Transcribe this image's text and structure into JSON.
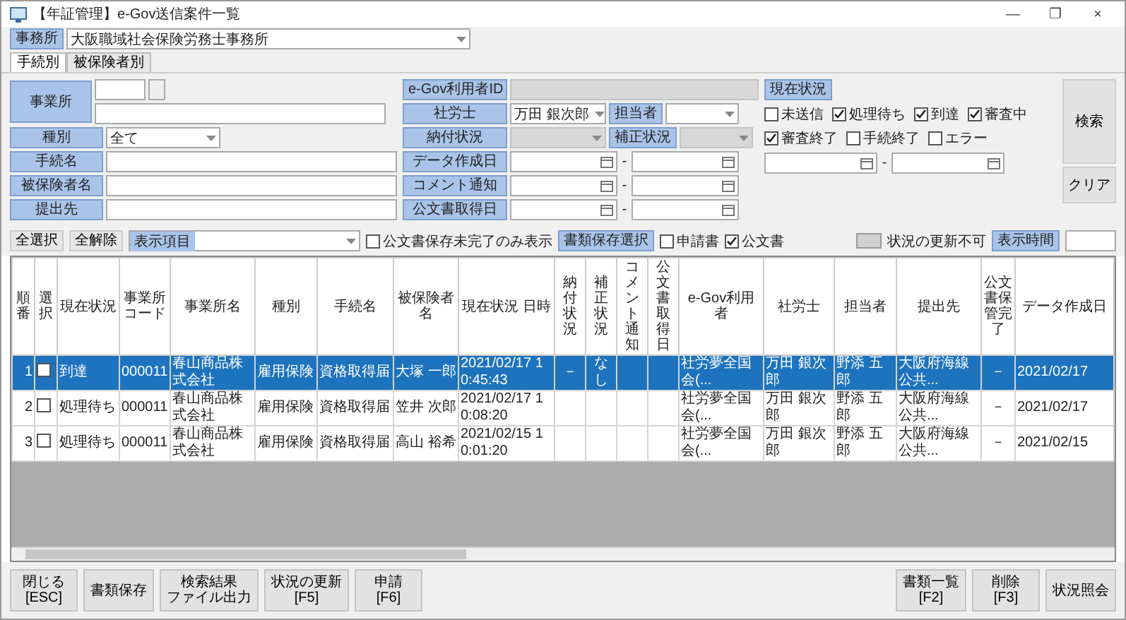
{
  "window": {
    "title": "【年証管理】e-Gov送信案件一覧",
    "controls": [
      "—",
      "❐",
      "×"
    ]
  },
  "office": {
    "label": "事務所",
    "value": "大阪職域社会保険労務士事務所"
  },
  "tabs": [
    {
      "label": "手続別",
      "selected": true
    },
    {
      "label": "被保険者別",
      "selected": false
    }
  ],
  "search": {
    "left": [
      {
        "label": "事業所",
        "kind": "office"
      },
      {
        "label": "種別",
        "kind": "select",
        "value": "全て"
      },
      {
        "label": "手続名",
        "kind": "text"
      },
      {
        "label": "被保険者名",
        "kind": "text"
      },
      {
        "label": "提出先",
        "kind": "text"
      }
    ],
    "middle": [
      {
        "label": "e-Gov利用者ID",
        "kind": "text",
        "disabled": true
      },
      {
        "label": "社労士",
        "kind": "pair",
        "value": "万田 銀次郎",
        "label2": "担当者",
        "disabled": false
      },
      {
        "label": "納付状況",
        "kind": "pair",
        "label2": "補正状況",
        "disabled": true
      },
      {
        "label": "データ作成日",
        "kind": "date",
        "disabled": false
      },
      {
        "label": "コメント通知",
        "kind": "date",
        "disabled": false
      },
      {
        "label": "公文書取得日",
        "kind": "date",
        "disabled": false
      }
    ],
    "date_separator": "-",
    "status": {
      "label": "現在状況",
      "options": [
        {
          "label": "未送信",
          "checked": false
        },
        {
          "label": "処理待ち",
          "checked": true
        },
        {
          "label": "到達",
          "checked": true
        },
        {
          "label": "審査中",
          "checked": true
        },
        {
          "label": "審査終了",
          "checked": true
        },
        {
          "label": "手続終了",
          "checked": false
        },
        {
          "label": "エラー",
          "checked": false
        }
      ]
    },
    "buttons": [
      "検索",
      "クリア"
    ]
  },
  "toolbar": {
    "select_all": "全選択",
    "deselect_all": "全解除",
    "columns_label": "表示項目",
    "only_unsaved": {
      "label": "公文書保存未完了のみ表示",
      "checked": false
    },
    "doc_save_label": "書類保存選択",
    "doc_options": [
      {
        "label": "申請書",
        "checked": false
      },
      {
        "label": "公文書",
        "checked": true
      }
    ],
    "legend": "状況の更新不可",
    "interval_label": "表示時間"
  },
  "table": {
    "columns": [
      "順番",
      "選択",
      "現在状況",
      "事業所コード",
      "事業所名",
      "種別",
      "手続名",
      "被保険者名",
      "現在状況 日時",
      "納付状況",
      "補正状況",
      "コメント通知",
      "公文書取得日",
      "e-Gov利用者",
      "社労士",
      "担当者",
      "提出先",
      "公文書保管完了",
      "データ作成日"
    ],
    "rows": [
      {
        "selected": true,
        "checked": false,
        "cells": [
          "1",
          "",
          "到達",
          "000011",
          "春山商品株式会社",
          "雇用保険",
          "資格取得届",
          "大塚 一郎",
          "2021/02/17 10:45:43",
          "－",
          "なし",
          "",
          "",
          "社労夢全国会(...",
          "万田 銀次郎",
          "野添 五郎",
          "大阪府海線公共...",
          "－",
          "2021/02/17"
        ]
      },
      {
        "selected": false,
        "checked": false,
        "cells": [
          "2",
          "",
          "処理待ち",
          "000011",
          "春山商品株式会社",
          "雇用保険",
          "資格取得届",
          "笠井 次郎",
          "2021/02/17 10:08:20",
          "",
          "",
          "",
          "",
          "社労夢全国会(...",
          "万田 銀次郎",
          "野添 五郎",
          "大阪府海線公共...",
          "－",
          "2021/02/17"
        ]
      },
      {
        "selected": false,
        "checked": false,
        "cells": [
          "3",
          "",
          "処理待ち",
          "000011",
          "春山商品株式会社",
          "雇用保険",
          "資格取得届",
          "高山 裕希",
          "2021/02/15 10:01:20",
          "",
          "",
          "",
          "",
          "社労夢全国会(...",
          "万田 銀次郎",
          "野添 五郎",
          "大阪府海線公共...",
          "－",
          "2021/02/15"
        ]
      }
    ]
  },
  "footer": {
    "left": [
      [
        "閉じる",
        "[ESC]"
      ],
      [
        "書類保存"
      ],
      [
        "検索結果",
        "ファイル出力"
      ],
      [
        "状況の更新",
        "[F5]"
      ],
      [
        "申請",
        "[F6]"
      ]
    ],
    "right": [
      [
        "書類一覧",
        "[F2]"
      ],
      [
        "削除",
        "[F3]"
      ],
      [
        "状況照会"
      ]
    ]
  }
}
